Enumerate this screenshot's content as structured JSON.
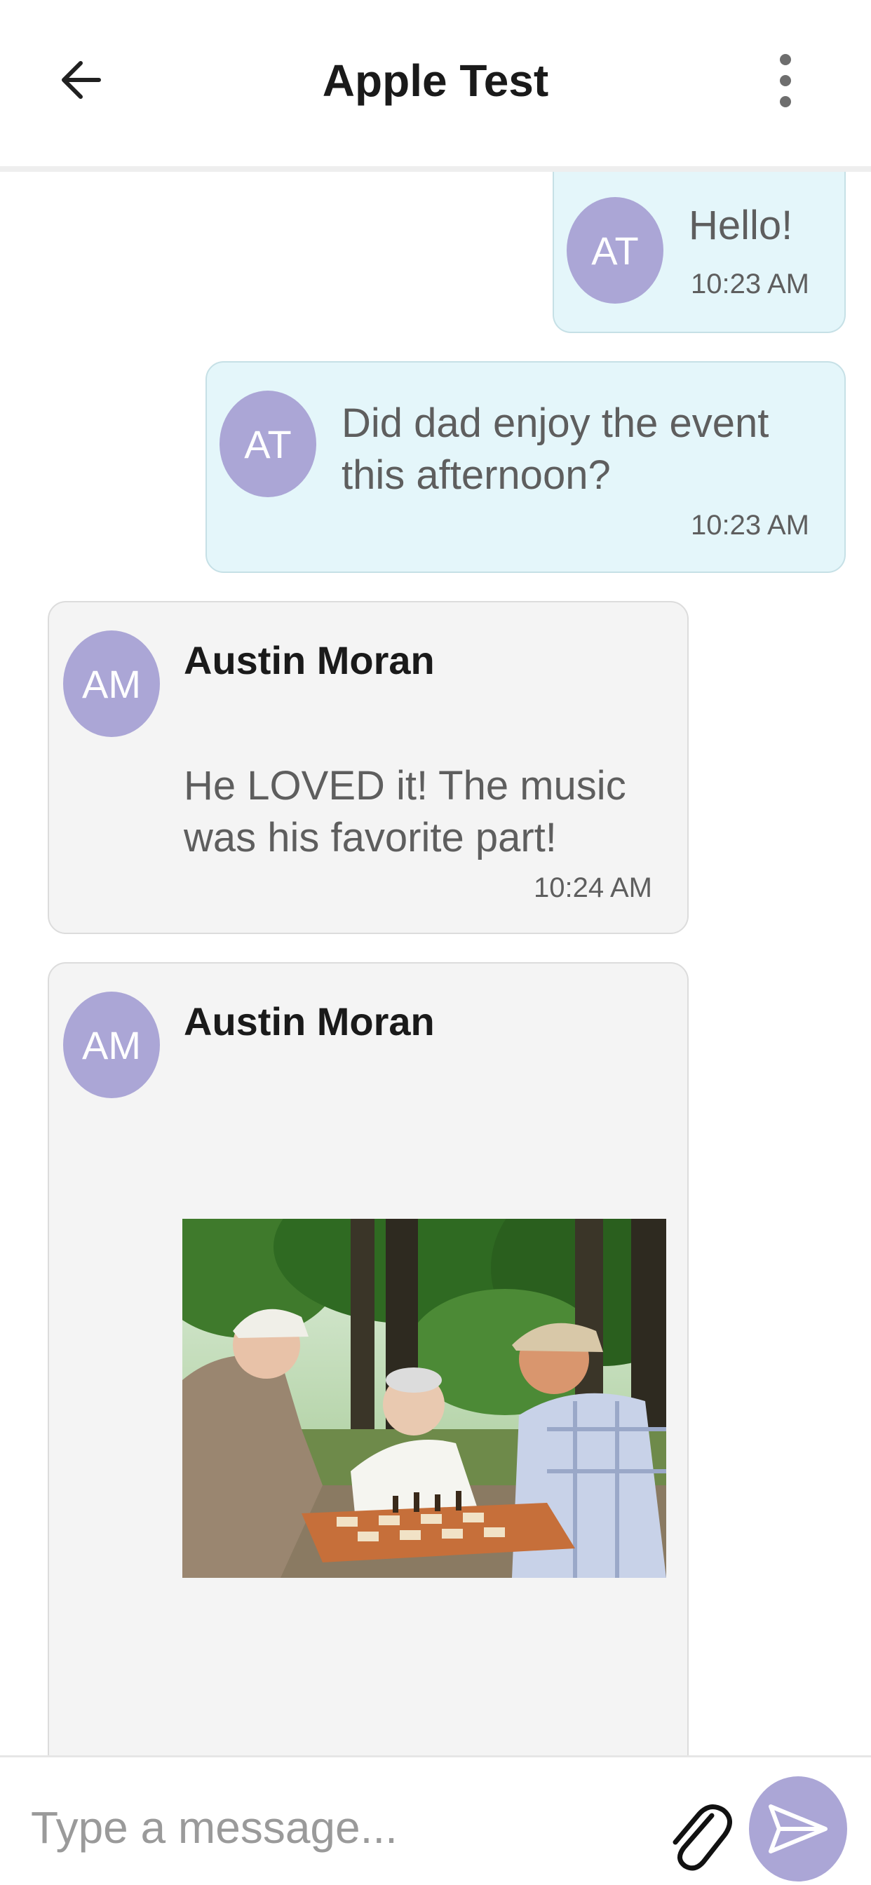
{
  "header": {
    "title": "Apple Test",
    "back_icon": "arrow-left-icon",
    "menu_icon": "more-vertical-icon"
  },
  "messages": [
    {
      "direction": "outgoing",
      "avatar_initials": "AT",
      "text": "Hello!",
      "time": "10:23 AM"
    },
    {
      "direction": "outgoing",
      "avatar_initials": "AT",
      "text": "Did dad enjoy the event\nthis afternoon?",
      "time": "10:23 AM"
    },
    {
      "direction": "incoming",
      "avatar_initials": "AM",
      "sender": "Austin Moran",
      "text": "He LOVED it! The music\nwas his favorite part!",
      "time": "10:24 AM"
    },
    {
      "direction": "incoming",
      "avatar_initials": "AM",
      "sender": "Austin Moran",
      "image": "photo of elderly men playing chess outdoors in a park"
    }
  ],
  "composer": {
    "placeholder": "Type a message...",
    "attach_icon": "paperclip-icon",
    "send_icon": "send-icon"
  },
  "colors": {
    "avatar": "#aba6d6",
    "outgoing_bubble": "#e4f6fa",
    "incoming_bubble": "#f4f4f4",
    "send_button": "#aba6d6"
  }
}
